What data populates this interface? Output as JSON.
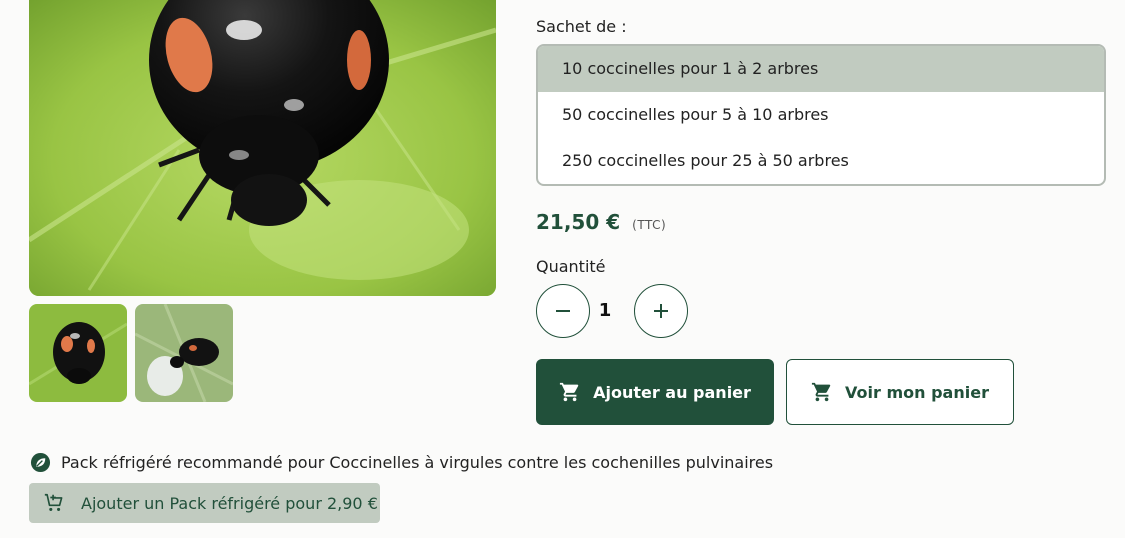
{
  "gallery": {
    "main_image": "ladybird-photo",
    "thumbnails": [
      "ladybird-thumbnail-1",
      "ladybird-thumbnail-2"
    ]
  },
  "product": {
    "size_label": "Sachet de :",
    "options": [
      "10 coccinelles pour 1 à 2 arbres",
      "50 coccinelles pour 5 à 10 arbres",
      "250 coccinelles pour 25 à 50 arbres"
    ],
    "selected_option": "10 coccinelles pour 1 à 2 arbres",
    "price": "21,50 €",
    "price_suffix": "(TTC)",
    "quantity_label": "Quantité",
    "quantity_value": "1",
    "add_to_cart_label": "Ajouter au panier",
    "view_cart_label": "Voir mon panier"
  },
  "pack": {
    "note": "Pack réfrigéré recommandé pour Coccinelles à virgules contre les cochenilles pulvinaires",
    "button_label": "Ajouter un Pack réfrigéré pour 2,90 €"
  },
  "icons": {
    "minus": "minus-icon",
    "plus": "plus-icon",
    "cart": "cart-icon",
    "cart_add": "cart-add-icon",
    "leaf_badge": "leaf-badge-icon"
  },
  "colors": {
    "brand_green": "#21503a",
    "selected_option_bg": "#c1cbc0",
    "pack_button_bg": "#c1cbc0",
    "background": "#fbfbfa"
  }
}
